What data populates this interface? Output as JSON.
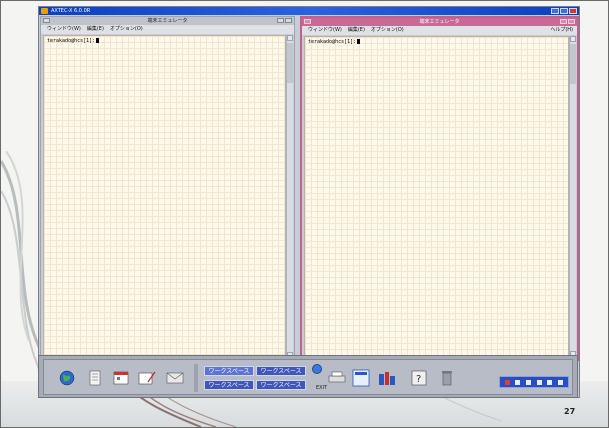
{
  "outer_window": {
    "title": "AXTEC-X 6.0.0R"
  },
  "terminal_left": {
    "title": "端末エミュレータ",
    "menu": [
      "ウィンドウ(W)",
      "編集(E)",
      "オプション(O)"
    ],
    "prompt": "terakado@hcs[1]:"
  },
  "terminal_right": {
    "title": "端末エミュレータ",
    "menu": [
      "ウィンドウ(W)",
      "編集(E)",
      "オプション(O)"
    ],
    "help": "ヘルプ(H)",
    "prompt": "terakado@hcs[1]:"
  },
  "front_panel": {
    "workspaces": [
      "ワークスペース",
      "ワークスペース",
      "ワークスペース",
      "ワークスペース"
    ],
    "exit_label": "EXIT"
  },
  "page_number": "27",
  "colors": {
    "title_active": "#c86a96",
    "title_bar_outer": "#0a3fbf",
    "terminal_bg": "#fdf8ea",
    "workspace_button": "#4057b8"
  },
  "icons": [
    "globe-icon",
    "document-icon",
    "calendar-icon",
    "editor-icon",
    "mail-icon",
    "printer-icon",
    "style-manager-icon",
    "app-manager-icon",
    "help-icon",
    "trash-icon"
  ]
}
